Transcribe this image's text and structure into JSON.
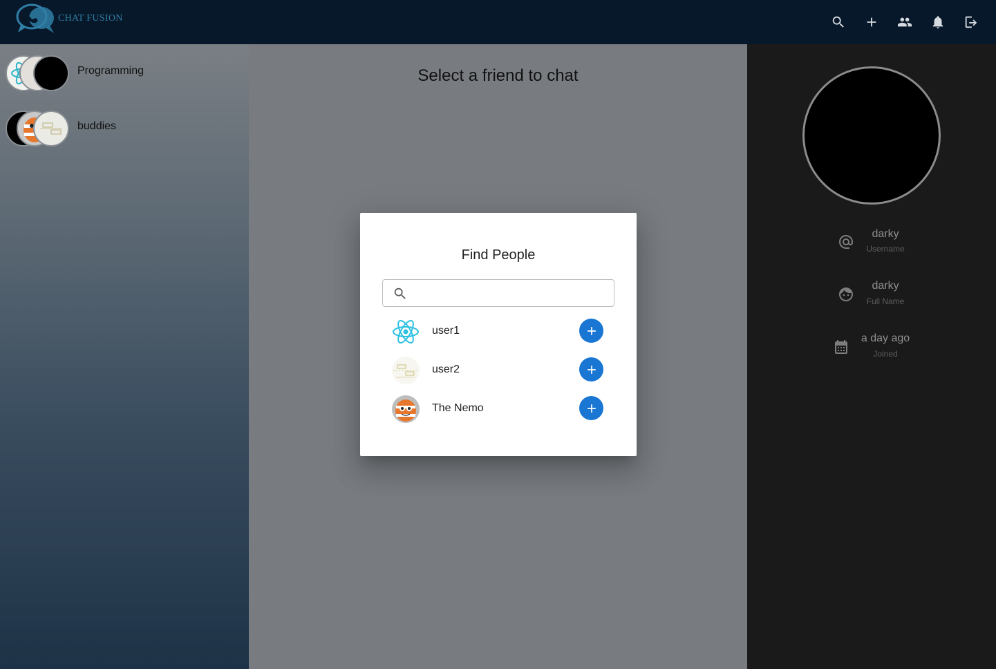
{
  "app": {
    "title": "CHAT FUSION"
  },
  "toolbar": {
    "icons": [
      "search-icon",
      "add-icon",
      "group-icon",
      "notifications-icon",
      "logout-icon"
    ]
  },
  "sidebar": {
    "groups": [
      {
        "label": "Programming"
      },
      {
        "label": "buddies"
      }
    ]
  },
  "main": {
    "title": "Select a friend to chat"
  },
  "profile": {
    "username": "darky",
    "username_label": "Username",
    "full_name": "darky",
    "full_name_label": "Full Name",
    "joined": "a day ago",
    "joined_label": "Joined"
  },
  "dialog": {
    "title": "Find People",
    "search": {
      "value": "",
      "placeholder": ""
    },
    "users": [
      {
        "name": "user1",
        "avatar": "react-logo"
      },
      {
        "name": "user2",
        "avatar": "sketch-image"
      },
      {
        "name": "The Nemo",
        "avatar": "clownfish"
      }
    ]
  },
  "colors": {
    "topbar": "#07182a",
    "accent": "#1976d2",
    "right_panel": "#1a1a1a",
    "logo": "#2f7fa6"
  }
}
